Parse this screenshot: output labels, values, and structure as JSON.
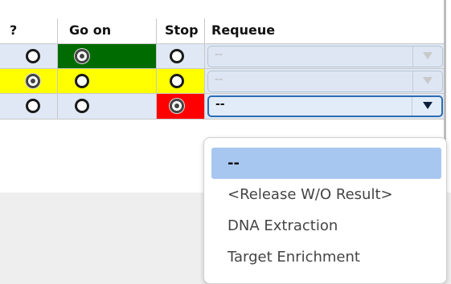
{
  "columns": {
    "unknown": "?",
    "go_on": "Go on",
    "stop": "Stop",
    "requeue": "Requeue"
  },
  "rows": [
    {
      "selected": "go_on",
      "requeue_value": "--",
      "highlight_color": "#006b00"
    },
    {
      "selected": "unknown",
      "requeue_value": "--",
      "highlight_color": "#ffff00"
    },
    {
      "selected": "stop",
      "requeue_value": "--",
      "highlight_color": "#ff0000"
    }
  ],
  "requeue_dropdown": {
    "options": [
      "--",
      "<Release W/O Result>",
      "DNA Extraction",
      "Target Enrichment"
    ],
    "selected_index": 0
  },
  "colors": {
    "row_background": "#dfe8f4",
    "select_highlight": "#a8c7f0",
    "active_border": "#2b6cb3"
  }
}
